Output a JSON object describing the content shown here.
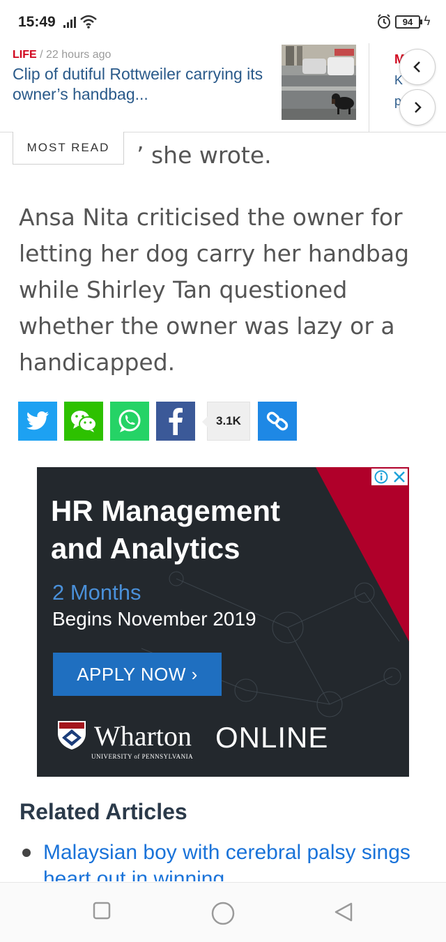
{
  "status_bar": {
    "time": "15:49",
    "battery": "94"
  },
  "strip": {
    "category": "LIFE",
    "separator": "/",
    "time": "22 hours ago",
    "title": "Clip of dutiful Rottweiler carrying its owner’s handbag...",
    "next_category": "M",
    "next_line2": "K",
    "next_line3": "p"
  },
  "most_read": {
    "label": "MOST READ"
  },
  "article": {
    "fragment": "’ she wrote.",
    "paragraph": "Ansa Nita criticised the owner for letting her dog carry her handbag while Shirley Tan questioned whether the owner was lazy or a handicapped."
  },
  "share": {
    "count": "3.1K",
    "buttons": [
      "twitter-icon",
      "wechat-icon",
      "whatsapp-icon",
      "facebook-icon",
      "link-icon"
    ],
    "colors": {
      "twitter": "#1da1f2",
      "wechat": "#2dc100",
      "whatsapp": "#25d366",
      "facebook": "#3b5998",
      "link": "#1e88e5"
    }
  },
  "ad": {
    "headline_line1": "HR Management",
    "headline_line2": "and Analytics",
    "duration": "2 Months",
    "start": "Begins November 2019",
    "cta": "APPLY NOW ›",
    "brand": "Wharton",
    "brand_sub": "UNIVERSITY of PENNSYLVANIA",
    "online": "ONLINE",
    "colors": {
      "accent": "#b0002a",
      "cta": "#1f6fc0",
      "duration": "#4a90d9"
    }
  },
  "related": {
    "heading": "Related Articles",
    "items": [
      "Malaysian boy with cerebral palsy sings heart out in winning"
    ]
  },
  "nav_bar": {
    "icons": [
      "recent-apps-icon",
      "home-icon",
      "back-icon"
    ]
  }
}
